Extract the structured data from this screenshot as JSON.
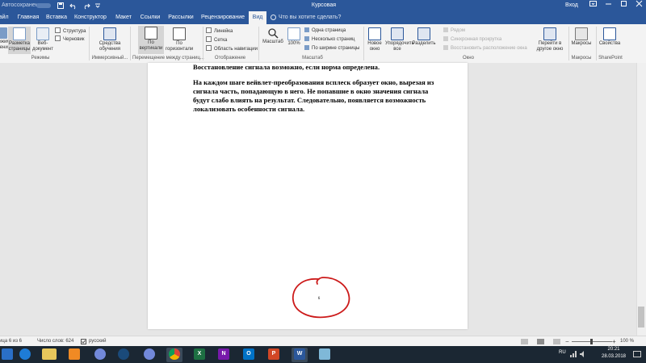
{
  "title_bar": {
    "autosave_label": "Автосохранение",
    "document_title": "Курсовая",
    "login_label": "Вход",
    "window_buttons": {
      "options": "ribbon-display-options-icon",
      "minimize": "minimize-icon",
      "maximize": "maximize-icon",
      "close": "close-icon"
    },
    "quick_access": [
      "save-icon",
      "undo-icon",
      "redo-icon",
      "customize-icon"
    ]
  },
  "tabs": [
    "Файл",
    "Главная",
    "Вставка",
    "Конструктор",
    "Макет",
    "Ссылки",
    "Рассылки",
    "Рецензирование",
    "Вид"
  ],
  "active_tab": "Вид",
  "tell_me": "Что вы хотите сделать?",
  "ribbon": {
    "views": {
      "read_mode": "Режим чтения",
      "print_layout": "Разметка страницы",
      "web_layout": "Веб-документ",
      "outline": "Структура",
      "draft": "Черновик",
      "group_label": "Режимы"
    },
    "immersive": {
      "learning_tools": "Средства обучения",
      "group_label": "Иммерсивный..."
    },
    "page_movement": {
      "vertical": "По вертикали",
      "side_to_side": "По горизонтали",
      "group_label": "Перемещение между страниц..."
    },
    "show": {
      "ruler": "Линейка",
      "gridlines": "Сетка",
      "nav_pane": "Область навигации",
      "group_label": "Отображение"
    },
    "zoom": {
      "zoom": "Масштаб",
      "zoom100": "100%",
      "one_page": "Одна страница",
      "multiple_pages": "Несколько страниц",
      "page_width": "По ширине страницы",
      "group_label": "Масштаб"
    },
    "window": {
      "new_window": "Новое окно",
      "arrange_all": "Упорядочить все",
      "split": "Разделить",
      "side_by_side": "Рядом",
      "sync_scroll": "Синхронная прокрутка",
      "reset_position": "Восстановить расположение окна",
      "switch_windows": "Перейти в другое окно",
      "group_label": "Окно"
    },
    "macros": {
      "macros": "Макросы",
      "group_label": "Макросы"
    },
    "sharepoint": {
      "properties": "Свойства",
      "group_label": "SharePoint"
    }
  },
  "document": {
    "cut_line": "Восстановление сигнала возможно, если норма определена.",
    "para_lines": [
      "На каждом шаге вейвлет-преобразования всплеск образует окно, вырезая из",
      "сигнала часть, попадающую в него.  Не попавшие в  окно значения сигнала",
      "будут слабо влиять на  результат. Следовательно, появляется возможность",
      "локализовать особенности сигнала."
    ],
    "page_number": "6"
  },
  "status_bar": {
    "page_info": "Страница 6 из 6",
    "word_count": "Число слов: 624",
    "language": "русский",
    "zoom_minus": "−",
    "zoom_plus": "+",
    "zoom_percent": "100 %"
  },
  "taskbar": {
    "apps": [
      "start-icon",
      "edge-icon",
      "file-explorer-icon",
      "media-player-icon",
      "discord-icon",
      "steam-icon",
      "discord-icon",
      "chrome-icon",
      "excel-icon",
      "onenote-icon",
      "outlook-icon",
      "powerpoint-icon",
      "word-icon",
      "app-icon"
    ],
    "excel": "X",
    "onenote": "N",
    "outlook": "O",
    "powerpoint": "P",
    "word": "W",
    "lang": "RU",
    "time": "20:21",
    "date": "28.03.2018"
  },
  "colors": {
    "word_blue": "#2b579a",
    "ribbon_bg": "#f3f3f3",
    "annotation_red": "#cc1a1a",
    "taskbar_bg": "#1b2733"
  }
}
